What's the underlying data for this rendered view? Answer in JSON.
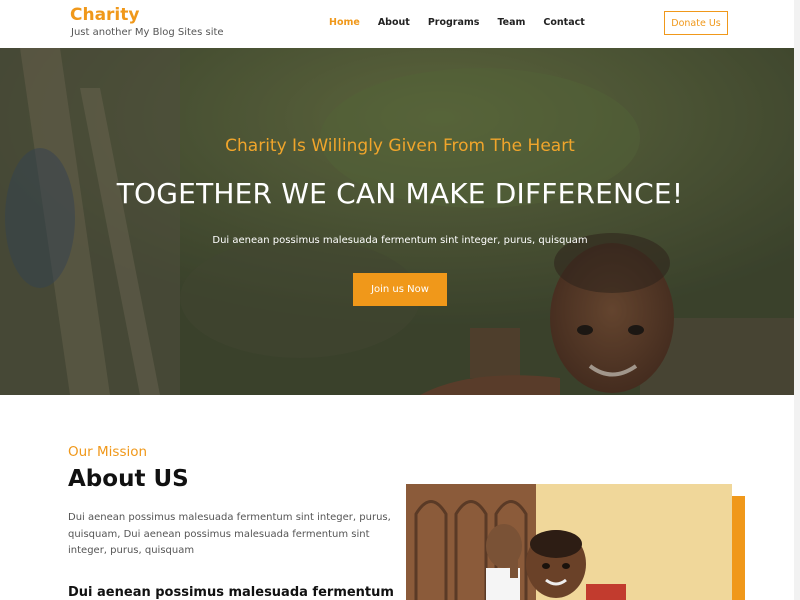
{
  "header": {
    "site_title": "Charity",
    "tagline": "Just another My Blog Sites site",
    "nav": [
      {
        "label": "Home",
        "active": true
      },
      {
        "label": "About",
        "active": false
      },
      {
        "label": "Programs",
        "active": false
      },
      {
        "label": "Team",
        "active": false
      },
      {
        "label": "Contact",
        "active": false
      }
    ],
    "donate_label": "Donate Us"
  },
  "hero": {
    "subtitle": "Charity Is Willingly Given From The Heart",
    "title": "TOGETHER WE CAN MAKE DIFFERENCE!",
    "text": "Dui aenean possimus malesuada fermentum sint integer, purus, quisquam",
    "button_label": "Join us Now"
  },
  "about": {
    "label": "Our Mission",
    "title": "About US",
    "text": "Dui aenean possimus malesuada fermentum sint integer, purus, quisquam, Dui aenean possimus malesuada fermentum sint integer, purus, quisquam",
    "subheading": "Dui aenean possimus malesuada fermentum"
  },
  "colors": {
    "accent": "#f0981a",
    "text_dark": "#111111",
    "text_muted": "#555555"
  }
}
